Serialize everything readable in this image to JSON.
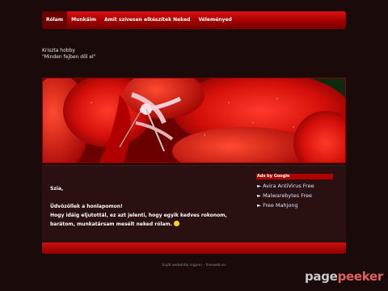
{
  "nav": {
    "items": [
      {
        "label": "Rólam",
        "active": true
      },
      {
        "label": "Munkáim",
        "active": false
      },
      {
        "label": "Amit szívesen elkészítek Neked",
        "active": false
      },
      {
        "label": "Véleményed",
        "active": false
      }
    ]
  },
  "site": {
    "title": "Kriszta hobby",
    "slogan": "\"Minden fejben dől el\""
  },
  "hero": {
    "image_subject": "red flower close-up"
  },
  "content": {
    "greeting": "Szia,",
    "welcome": "Üdvözöllek a honlapomon!",
    "paragraph": "Hogy idáig eljutottál, ez azt jelenti, hogy egyik kedves rokonom, barátom, munkatársam mesélt neked rólam."
  },
  "ads": {
    "header": "Ads by Google",
    "links": [
      "► Avira AntiVirus Free",
      "► Malwarebytes Free",
      "► Free Mahjong"
    ]
  },
  "footer": {
    "text": "Saját weboldal ingyen - freeweb.eu"
  },
  "watermark": {
    "part1": "page",
    "part2": "peeker"
  },
  "colors": {
    "accent": "#c00000",
    "background": "#1a0a0a",
    "link": "#dbe4ff"
  }
}
